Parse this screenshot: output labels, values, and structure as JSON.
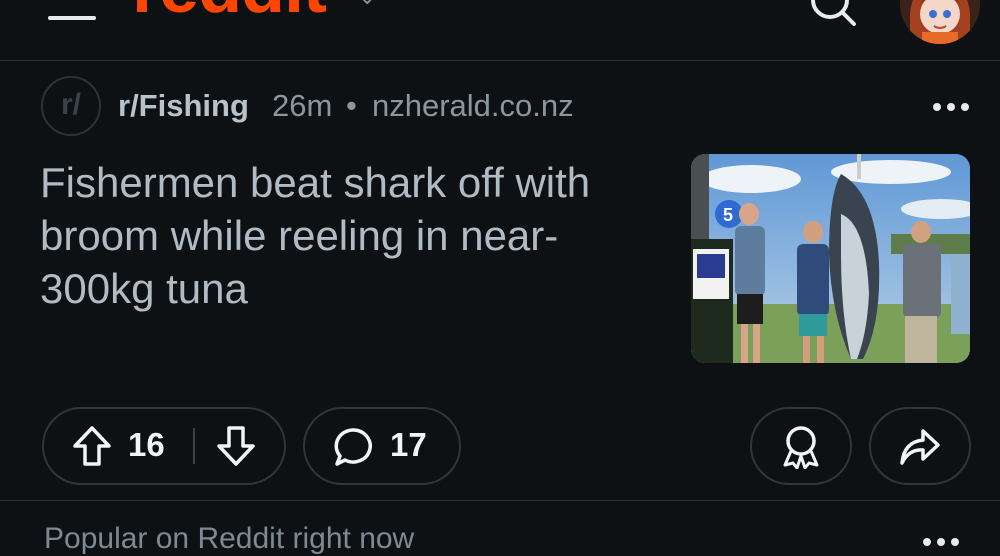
{
  "header": {
    "logo_text": "reddit",
    "logo_chevron": "⌄",
    "menu_icon": "hamburger-icon",
    "search_icon": "search-icon",
    "avatar_icon": "user-avatar"
  },
  "post": {
    "subreddit": "r/Fishing",
    "subreddit_icon_text": "r/",
    "age": "26m",
    "separator": "•",
    "domain": "nzherald.co.nz",
    "title": "Fishermen beat shark off with broom while reeling in near-300kg tuna",
    "thumbnail_alt": "Three fishermen standing beside a large tuna hanging from a scale",
    "upvotes": "16",
    "comments": "17"
  },
  "section": {
    "title": "Popular on Reddit right now"
  },
  "colors": {
    "brand": "#ff4500",
    "background": "#0e1113",
    "text": "#b7c2cb"
  }
}
